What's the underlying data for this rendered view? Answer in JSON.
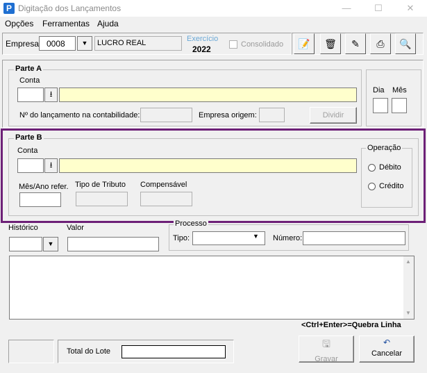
{
  "window": {
    "title": "Digitação dos Lançamentos",
    "app_icon_letter": "P",
    "minimize": "—",
    "maximize": "☐",
    "close": "✕"
  },
  "menu": [
    "Opções",
    "Ferramentas",
    "Ajuda"
  ],
  "header": {
    "empresa_label": "Empresa:",
    "empresa_value": "0008",
    "empresa_nome": "LUCRO REAL",
    "exercicio_label": "Exercício",
    "exercicio_value": "2022",
    "consolidado_label": "Consolidado"
  },
  "toolbar_icons": [
    "notes-icon",
    "recycle-bin-icon",
    "edit-icon",
    "printer-icon",
    "preview-icon"
  ],
  "parte_a": {
    "title": "Parte A",
    "conta_label": "Conta",
    "conta_code": "",
    "conta_desc": "",
    "lancamento_label": "Nº do lançamento na contabilidade:",
    "empresa_origem_label": "Empresa origem:",
    "dividir_label": "Dividir"
  },
  "dia_label": "Dia",
  "mes_label": "Mês",
  "parte_b": {
    "title": "Parte B",
    "conta_label": "Conta",
    "mes_ano_label": "Mês/Ano refer.",
    "tipo_tributo_label": "Tipo de Tributo",
    "compensavel_label": "Compensável",
    "operacao_label": "Operação",
    "debito_label": "Débito",
    "credito_label": "Crédito"
  },
  "historico_label": "Histórico",
  "valor_label": "Valor",
  "processo": {
    "title": "Processo",
    "tipo_label": "Tipo:",
    "numero_label": "Número:"
  },
  "hint": "<Ctrl+Enter>=Quebra Linha",
  "total_lote_label": "Total do Lote",
  "gravar_label": "Gravar",
  "cancelar_label": "Cancelar"
}
